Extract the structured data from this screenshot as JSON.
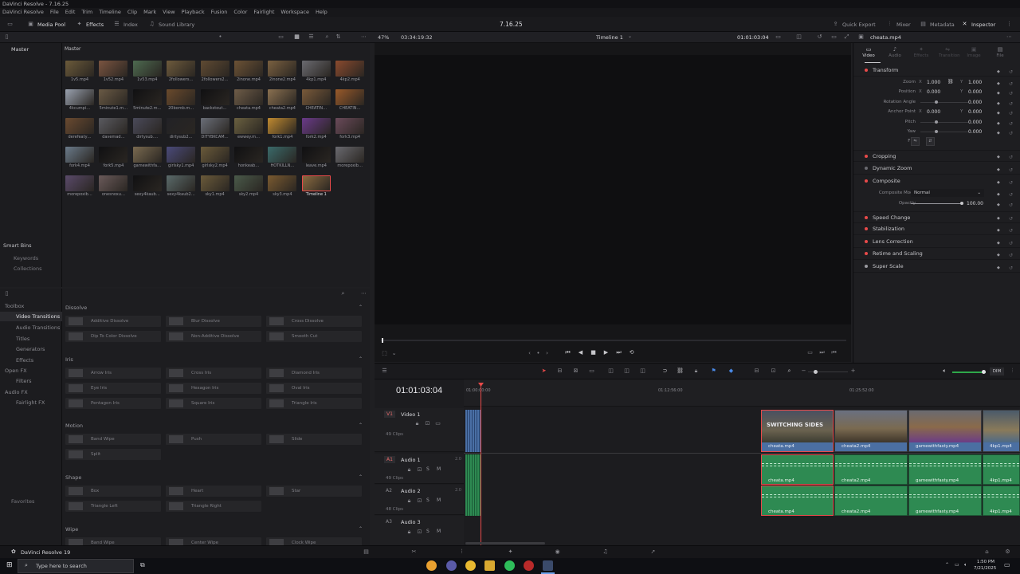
{
  "window": {
    "title": "DaVinci Resolve - 7.16.25"
  },
  "menu": [
    "DaVinci Resolve",
    "File",
    "Edit",
    "Trim",
    "Timeline",
    "Clip",
    "Mark",
    "View",
    "Playback",
    "Fusion",
    "Color",
    "Fairlight",
    "Workspace",
    "Help"
  ],
  "toolbar": {
    "media_pool": "Media Pool",
    "effects": "Effects",
    "index": "Index",
    "sound_library": "Sound Library",
    "project_name": "7.16.25",
    "quick_export": "Quick Export",
    "mixer": "Mixer",
    "metadata": "Metadata",
    "inspector": "Inspector"
  },
  "viewer_bar": {
    "zoom": "47%",
    "timecode_left": "03:34:19:32",
    "timeline_name": "Timeline 1",
    "timecode_right": "01:01:03:04",
    "clip_name": "cheata.mp4"
  },
  "bins": {
    "master": "Master",
    "smart_bins": "Smart Bins",
    "keywords": "Keywords",
    "collections": "Collections"
  },
  "pool": {
    "header": "Master",
    "clips": [
      {
        "name": "1v5.mp4",
        "c": "#6b5a3a"
      },
      {
        "name": "1v52.mp4",
        "c": "#7a5440"
      },
      {
        "name": "1v53.mp4",
        "c": "#4d6a50"
      },
      {
        "name": "2followers…",
        "c": "#6d5a3c"
      },
      {
        "name": "2followers2…",
        "c": "#5f4a32"
      },
      {
        "name": "2inone.mp4",
        "c": "#6c5235"
      },
      {
        "name": "2inone2.mp4",
        "c": "#7a6040"
      },
      {
        "name": "4kp1.mp4",
        "c": "#6a6a70"
      },
      {
        "name": "4kp2.mp4",
        "c": "#8a4a2e"
      },
      {
        "name": "4kcumpi…",
        "c": "#9aa2b0"
      },
      {
        "name": "5minute1.m…",
        "c": "#6a5a45"
      },
      {
        "name": "5minute2.m…",
        "c": "#101012"
      },
      {
        "name": "20bomb.m…",
        "c": "#6a4a2c"
      },
      {
        "name": "backstout…",
        "c": "#101012"
      },
      {
        "name": "cheata.mp4",
        "c": "#6e5c48"
      },
      {
        "name": "cheata2.mp4",
        "c": "#8a7050"
      },
      {
        "name": "CHEATIN…",
        "c": "#7a5a3a"
      },
      {
        "name": "CHEATIN…",
        "c": "#9a5a2a"
      },
      {
        "name": "derefeaty…",
        "c": "#6a4a30"
      },
      {
        "name": "davemad…",
        "c": "#5a5a60"
      },
      {
        "name": "dirtysub.…",
        "c": "#4a4a5a"
      },
      {
        "name": "dirtysub2…",
        "c": "#222226"
      },
      {
        "name": "DITYBKCAM…",
        "c": "#6a6e78"
      },
      {
        "name": "ewwey.m…",
        "c": "#6a6040"
      },
      {
        "name": "fork1.mp4",
        "c": "#c08a30"
      },
      {
        "name": "fork2.mp4",
        "c": "#6a3a8a"
      },
      {
        "name": "fork3.mp4",
        "c": "#6a4a5a"
      },
      {
        "name": "fork4.mp4",
        "c": "#6a7a8a"
      },
      {
        "name": "fork5.mp4",
        "c": "#101012"
      },
      {
        "name": "gamewithfa…",
        "c": "#7a6a50"
      },
      {
        "name": "girlsky1.mp4",
        "c": "#4a4a7a"
      },
      {
        "name": "girlsky2.mp4",
        "c": "#6a5a3a"
      },
      {
        "name": "honkeab…",
        "c": "#101012"
      },
      {
        "name": "HOTKILLN…",
        "c": "#3a6a6a"
      },
      {
        "name": "leave.mp4",
        "c": "#101012"
      },
      {
        "name": "morepoxib…",
        "c": "#6a6a70"
      },
      {
        "name": "morepoxib…",
        "c": "#5a4a6a"
      },
      {
        "name": "onesnoxu…",
        "c": "#6a5a5a"
      },
      {
        "name": "sexy4kaub…",
        "c": "#101012"
      },
      {
        "name": "sexy4kaub2…",
        "c": "#5a6a6a"
      },
      {
        "name": "sky1.mp4",
        "c": "#6a5a3a"
      },
      {
        "name": "sky2.mp4",
        "c": "#4a5a4a"
      },
      {
        "name": "sky3.mp4",
        "c": "#7a5a30"
      },
      {
        "name": "Timeline 1",
        "c": "#8a6a40"
      }
    ]
  },
  "toolbox": {
    "items": [
      "Toolbox",
      "Video Transitions",
      "Audio Transitions",
      "Titles",
      "Generators",
      "Effects",
      "Open FX",
      "Filters",
      "Audio FX",
      "Fairlight FX"
    ],
    "favorites": "Favorites"
  },
  "effects": {
    "dissolve": {
      "title": "Dissolve",
      "items": [
        "Additive Dissolve",
        "Blur Dissolve",
        "Cross Dissolve",
        "Dip To Color Dissolve",
        "Non-Additive Dissolve",
        "Smooth Cut"
      ]
    },
    "iris": {
      "title": "Iris",
      "items": [
        "Arrow Iris",
        "Cross Iris",
        "Diamond Iris",
        "Eye Iris",
        "Hexagon Iris",
        "Oval Iris",
        "Pentagon Iris",
        "Square Iris",
        "Triangle Iris"
      ]
    },
    "motion": {
      "title": "Motion",
      "items": [
        "Band Wipe",
        "Push",
        "Slide",
        "Split"
      ]
    },
    "shape": {
      "title": "Shape",
      "items": [
        "Box",
        "Heart",
        "Star",
        "Triangle Left",
        "Triangle Right"
      ]
    },
    "wipe": {
      "title": "Wipe",
      "items": [
        "Band Wipe",
        "Center Wipe",
        "Clock Wipe"
      ]
    }
  },
  "inspector": {
    "tabs": [
      "Video",
      "Audio",
      "Effects",
      "Transition",
      "Image",
      "File"
    ],
    "transform": "Transform",
    "zoom_label": "Zoom",
    "zoom_x": "1.000",
    "zoom_y": "1.000",
    "position_label": "Position",
    "position_x": "0.000",
    "position_y": "0.000",
    "rotation_label": "Rotation Angle",
    "rotation": "0.000",
    "anchor_label": "Anchor Point",
    "anchor_x": "0.000",
    "anchor_y": "0.000",
    "pitch_label": "Pitch",
    "pitch": "0.000",
    "yaw_label": "Yaw",
    "yaw": "0.000",
    "flip_label": "Flip",
    "sections": [
      "Cropping",
      "Dynamic Zoom",
      "Composite",
      "Speed Change",
      "Stabilization",
      "Lens Correction",
      "Retime and Scaling",
      "Super Scale"
    ],
    "composite_mode_label": "Composite Mode",
    "composite_mode": "Normal",
    "opacity_label": "Opacity",
    "opacity": "100.00",
    "x": "X",
    "y": "Y"
  },
  "timeline": {
    "timecode": "01:01:03:04",
    "ruler": [
      "01:00:00:00",
      "01:12:56:00",
      "01:25:52:00"
    ],
    "video_tracks": [
      {
        "id": "V1",
        "name": "Video 1",
        "clips": "49 Clips"
      }
    ],
    "audio_tracks": [
      {
        "id": "A1",
        "name": "Audio 1",
        "clips": "49 Clips",
        "ch": "2.0"
      },
      {
        "id": "A2",
        "name": "Audio 2",
        "clips": "48 Clips",
        "ch": "2.0"
      },
      {
        "id": "A3",
        "name": "Audio 3",
        "ch": ""
      }
    ],
    "v_clips": [
      "cheata.mp4",
      "cheata2.mp4",
      "gamewithfasty.mp4",
      "4kp1.mp4"
    ],
    "clip_title": "SWITCHING SIDES",
    "dim": "DIM"
  },
  "status": {
    "app": "DaVinci Resolve 19"
  },
  "taskbar": {
    "search": "Type here to search",
    "time": "1:50 PM",
    "date": "7/21/2025"
  }
}
